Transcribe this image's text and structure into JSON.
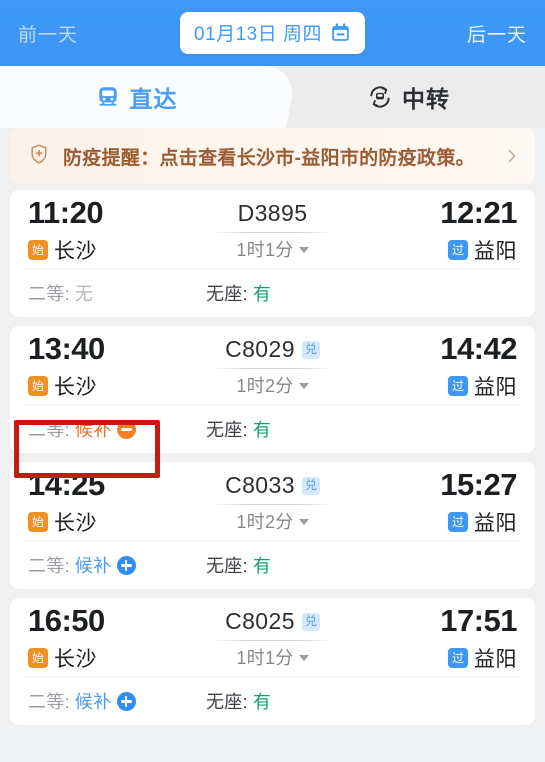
{
  "header": {
    "prev_day_label": "前一天",
    "next_day_label": "后一天",
    "date_label": "01月13日 周四",
    "calendar_icon": "calendar-icon",
    "bg_color": "#3d97f5"
  },
  "tabs": [
    {
      "label": "直达",
      "icon": "train-icon",
      "active": true
    },
    {
      "label": "中转",
      "icon": "transfer-icon",
      "active": false
    }
  ],
  "notice": {
    "icon": "shield-plus-icon",
    "text": "防疫提醒：点击查看长沙市-益阳市的防疫政策。",
    "chevron_icon": "chevron-right-icon",
    "text_color": "#9a5c33"
  },
  "trains": [
    {
      "depart_time": "11:20",
      "depart_station": "长沙",
      "depart_badge": "始",
      "train_no": "D3895",
      "train_badge": "",
      "duration": "1时1分",
      "arrive_time": "12:21",
      "arrive_station": "益阳",
      "arrive_badge": "过",
      "seats": [
        {
          "label": "二等:",
          "value": "无",
          "state": "none",
          "icon": ""
        },
        {
          "label": "无座:",
          "value": "有",
          "state": "yes",
          "icon": ""
        }
      ]
    },
    {
      "depart_time": "13:40",
      "depart_station": "长沙",
      "depart_badge": "始",
      "train_no": "C8029",
      "train_badge": "兑",
      "duration": "1时2分",
      "arrive_time": "14:42",
      "arrive_station": "益阳",
      "arrive_badge": "过",
      "seats": [
        {
          "label": "二等:",
          "value": "候补",
          "state": "waitlist-minus",
          "icon": "minus-circle-icon"
        },
        {
          "label": "无座:",
          "value": "有",
          "state": "yes",
          "icon": ""
        }
      ],
      "highlighted": true
    },
    {
      "depart_time": "14:25",
      "depart_station": "长沙",
      "depart_badge": "始",
      "train_no": "C8033",
      "train_badge": "兑",
      "duration": "1时2分",
      "arrive_time": "15:27",
      "arrive_station": "益阳",
      "arrive_badge": "过",
      "seats": [
        {
          "label": "二等:",
          "value": "候补",
          "state": "waitlist-plus",
          "icon": "plus-circle-icon"
        },
        {
          "label": "无座:",
          "value": "有",
          "state": "yes",
          "icon": ""
        }
      ]
    },
    {
      "depart_time": "16:50",
      "depart_station": "长沙",
      "depart_badge": "始",
      "train_no": "C8025",
      "train_badge": "兑",
      "duration": "1时1分",
      "arrive_time": "17:51",
      "arrive_station": "益阳",
      "arrive_badge": "过",
      "seats": [
        {
          "label": "二等:",
          "value": "候补",
          "state": "waitlist-plus",
          "icon": "plus-circle-icon"
        },
        {
          "label": "无座:",
          "value": "有",
          "state": "yes",
          "icon": ""
        }
      ]
    }
  ],
  "highlight": {
    "color": "#c9180f"
  }
}
